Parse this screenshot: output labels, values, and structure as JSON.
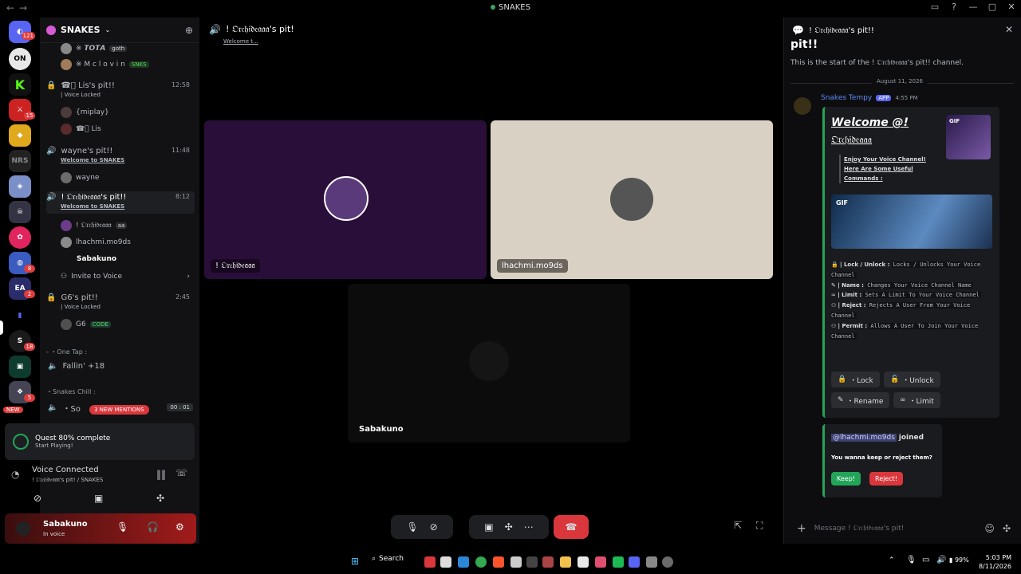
{
  "titlebar": {
    "title": "SNAKES"
  },
  "rail": {
    "discord_badge": "121",
    "badges": [
      "15",
      "8",
      "2",
      "18",
      "5"
    ],
    "new_label": "NEW"
  },
  "sidebar": {
    "server_name": "SNAKES",
    "top_users": [
      {
        "name": "※ 𝙏𝙊𝙏𝘼",
        "tag": "goth"
      },
      {
        "name": "※ M c l o v i n",
        "tag": "SNKS"
      }
    ],
    "channels": [
      {
        "name": "☎ﾟ Lis's pit!!",
        "time": "12:58",
        "sub": "| Voice Locked",
        "users": [
          "{miplay}",
          "☎ﾟ Lis"
        ]
      },
      {
        "name": "wayne's pit!!",
        "time": "11:48",
        "sub": "Welcome to SNAKES",
        "users": [
          "wayne"
        ]
      },
      {
        "name": "! 𝔒𝔯𝔠𝔥𝔦𝔡𝔢𝔞𝔞𝔞's pit!!",
        "time": "8:12",
        "sub": "Welcome to SNAKES",
        "users": [
          "! 𝔒𝔯𝔠𝔥𝔦𝔡𝔢𝔞𝔞𝔞",
          "lhachmi.mo9ds",
          "Sabakuno"
        ]
      },
      {
        "name": "G6's pit!!",
        "time": "2:45",
        "sub": "| Voice Locked",
        "users": [
          "G6"
        ]
      }
    ],
    "orchid_tag": "aa",
    "g6_tag": "CODE",
    "invite_label": "Invite to Voice",
    "category_one_tap": "- ・One Tap :",
    "fallin_channel": "Fallin' +18",
    "category_snakes_chill": "・Snakes Chill :",
    "mentions_pill": "3 NEW MENTIONS",
    "partial_channel": "・So",
    "partial_time": "00 : 01"
  },
  "quest": {
    "title": "Quest 80% complete",
    "subtitle": "Start Playing!"
  },
  "voice_connected": {
    "title": "Voice Connected",
    "subtitle": "! 𝔒𝔯𝔠𝔥𝔦𝔡𝔢𝔞𝔞𝔞's pit! / SNAKES"
  },
  "user_panel": {
    "name": "Sabakuno",
    "status": "In voice"
  },
  "stage": {
    "header_title": "! 𝔒𝔯𝔠𝔥𝔦𝔡𝔢𝔞𝔞𝔞's pit!",
    "header_sub": "Welcome t...",
    "tiles": [
      {
        "name": "! 𝔒𝔯𝔠𝔥𝔦𝔡𝔢𝔞𝔞𝔞",
        "color": "#2a0e3a"
      },
      {
        "name": "lhachmi.mo9ds",
        "color": "#d9d1c3"
      },
      {
        "name": "Sabakuno",
        "color": "#0c0c0d"
      }
    ]
  },
  "right_panel": {
    "header_title": "! 𝔒𝔯𝔠𝔥𝔦𝔡𝔢𝔞𝔞𝔞's pit!!",
    "big_title": "pit!!",
    "start_text": "This is the start of the ! 𝔒𝔯𝔠𝔥𝔦𝔡𝔢𝔞𝔞𝔞's pit!! channel.",
    "date_divider": "August 11, 2026",
    "bot_name": "Snakes Tempy",
    "app_badge": "APP",
    "msg_time": "4:55 PM",
    "embed": {
      "title_line1": "𝙒𝙚𝙡𝙘𝙤𝙢𝙚 @!",
      "title_line2": "𝔒𝔯𝔠𝔥𝔦𝔡𝔢𝔞𝔞𝔞",
      "gif_label": "GIF",
      "intro": "Enjoy Your Voice Channel! Here Are Some Useful Commands :",
      "commands": [
        {
          "name": "| Lock / Unlock :",
          "desc": "Locks / Unlocks Your Voice Channel"
        },
        {
          "name": "| Name :",
          "desc": "Changes Your Voice Channel Name"
        },
        {
          "name": "| Limit :",
          "desc": "Sets A Limit To Your Voice Channel"
        },
        {
          "name": "| Reject :",
          "desc": "Rejects A User From Your Voice Channel"
        },
        {
          "name": "| Permit :",
          "desc": "Allows A User To Join Your Voice Channel"
        }
      ],
      "buttons": [
        "・Lock",
        "・Unlock",
        "・Rename",
        "・Limit"
      ]
    },
    "join_card": {
      "mention": "@lhachmi.mo9ds",
      "joined": "joined",
      "question": "You wanna keep or reject them?",
      "keep": "Keep!",
      "reject": "Reject!"
    },
    "composer_placeholder": "Message ! 𝔒𝔯𝔠𝔥𝔦𝔡𝔢𝔞𝔞𝔞's pit!"
  },
  "taskbar": {
    "search": "Search",
    "battery": "99%",
    "time": "5:03 PM",
    "date": "8/11/2026"
  },
  "colors": {
    "accent_green": "#23a559",
    "danger_red": "#da373c",
    "purple_tile": "#2a0e3a",
    "beige_tile": "#d9d1c3",
    "brand": "#5865f2"
  }
}
